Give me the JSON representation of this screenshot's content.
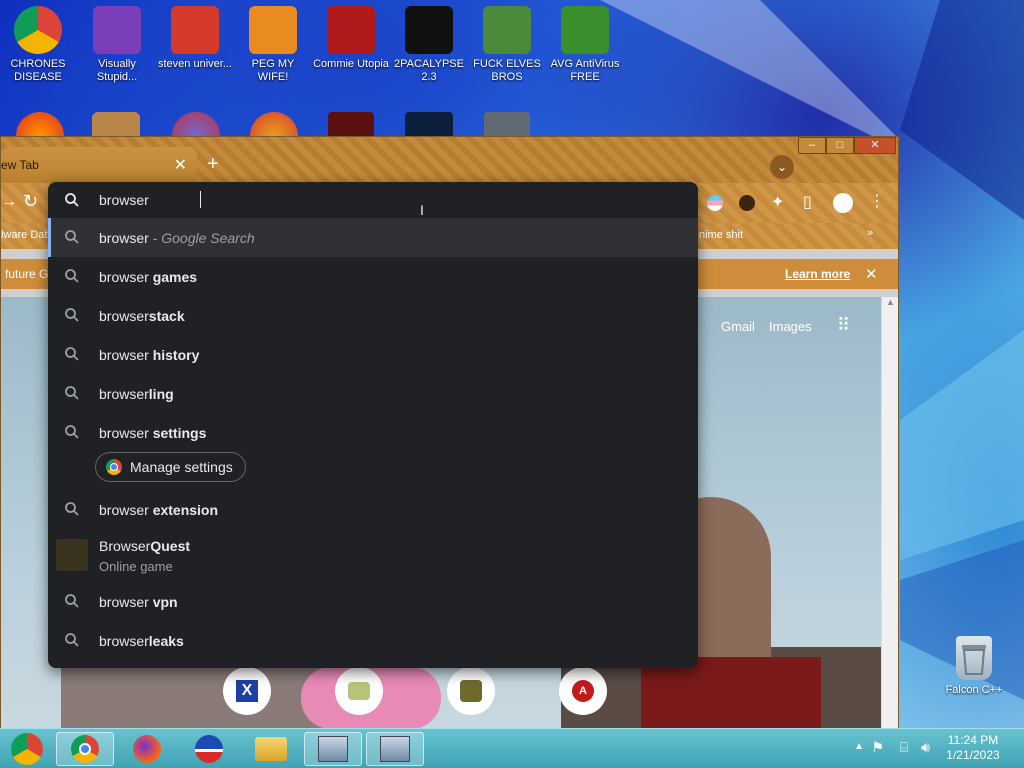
{
  "desktop": {
    "icons_row1": [
      {
        "label": "CHRONES DISEASE",
        "icon": "chrome-icon",
        "color": "#d93025"
      },
      {
        "label": "Visually Stupid...",
        "icon": "visual-studio-icon",
        "color": "#7a3fb8"
      },
      {
        "label": "steven univer...",
        "icon": "steven-universe-icon",
        "color": "#d63a2b"
      },
      {
        "label": "PEG MY WIFE!",
        "icon": "peggle-icon",
        "color": "#e98b1e"
      },
      {
        "label": "Commie Utopia",
        "icon": "commie-icon",
        "color": "#b01a1a"
      },
      {
        "label": "2PACALYPSE 2.3",
        "icon": "cmd-icon",
        "color": "#111111"
      },
      {
        "label": "FUCK ELVES BROS",
        "icon": "elf-icon",
        "color": "#4a8a3a"
      },
      {
        "label": "AVG AntiVirus FREE",
        "icon": "avg-icon",
        "color": "#3a8e2c"
      }
    ],
    "recycle_bin": "Falcon C++"
  },
  "browser": {
    "tab_title": "ew Tab",
    "bookmarks_left": "lware Dat",
    "bookmarks_right": "nime shit",
    "infobar_text": "future G",
    "learn_more": "Learn more",
    "page_links": {
      "gmail": "Gmail",
      "images": "Images"
    }
  },
  "omnibox": {
    "input_value": "browser",
    "suggestions": [
      {
        "pre": "browser",
        "bold": "",
        "sub": " - Google Search",
        "selected": true
      },
      {
        "pre": "browser ",
        "bold": "games"
      },
      {
        "pre": "browser",
        "bold": "stack"
      },
      {
        "pre": "browser ",
        "bold": "history"
      },
      {
        "pre": "browser",
        "bold": "ling"
      },
      {
        "pre": "browser ",
        "bold": "settings"
      },
      {
        "pre": "browser ",
        "bold": "extension"
      },
      {
        "pre": "browser ",
        "bold": "vpn"
      },
      {
        "pre": "browser",
        "bold": "leaks"
      }
    ],
    "manage_settings": "Manage settings",
    "quest": {
      "pre": "Browser",
      "bold": "Quest",
      "sub": "Online game"
    }
  },
  "taskbar": {
    "time": "11:24 PM",
    "date": "1/21/2023"
  }
}
